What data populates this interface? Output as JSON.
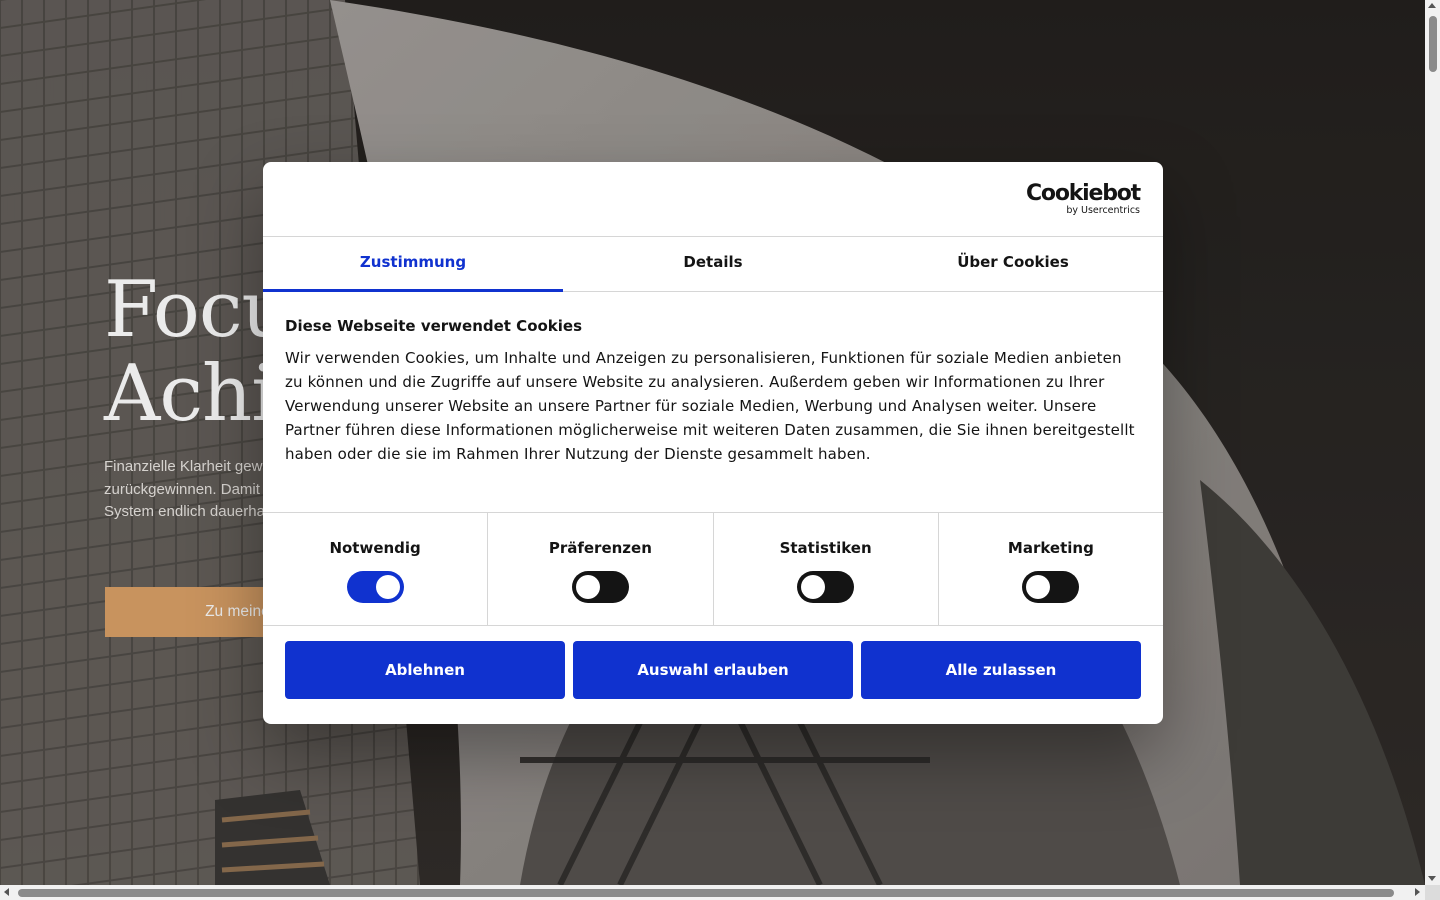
{
  "hero": {
    "title_line1": "Focu",
    "title_line2": "Achi",
    "text_lines": [
      "Finanzielle Klarheit gew",
      "zurückgewinnen. Damit",
      "System endlich dauerhaf"
    ],
    "cta_label": "Zu meinem Angeb"
  },
  "consent": {
    "logo": {
      "name": "Cookiebot",
      "sub": "by Usercentrics"
    },
    "tabs": [
      {
        "label": "Zustimmung",
        "active": true
      },
      {
        "label": "Details",
        "active": false
      },
      {
        "label": "Über Cookies",
        "active": false
      }
    ],
    "title": "Diese Webseite verwendet Cookies",
    "text": "Wir verwenden Cookies, um Inhalte und Anzeigen zu personalisieren, Funktionen für soziale Medien anbieten zu können und die Zugriffe auf unsere Website zu analysieren. Außerdem geben wir Informationen zu Ihrer Verwendung unserer Website an unsere Partner für soziale Medien, Werbung und Analysen weiter. Unsere Partner führen diese Informationen möglicherweise mit weiteren Daten zusammen, die Sie ihnen bereitgestellt haben oder die sie im Rahmen Ihrer Nutzung der Dienste gesammelt haben.",
    "toggles": [
      {
        "label": "Notwendig",
        "checked": true
      },
      {
        "label": "Präferenzen",
        "checked": false
      },
      {
        "label": "Statistiken",
        "checked": false
      },
      {
        "label": "Marketing",
        "checked": false
      }
    ],
    "buttons": {
      "decline": "Ablehnen",
      "allow_selection": "Auswahl erlauben",
      "allow_all": "Alle zulassen"
    },
    "colors": {
      "accent": "#1032cf",
      "text": "#141414",
      "cta": "#d9a066"
    }
  }
}
